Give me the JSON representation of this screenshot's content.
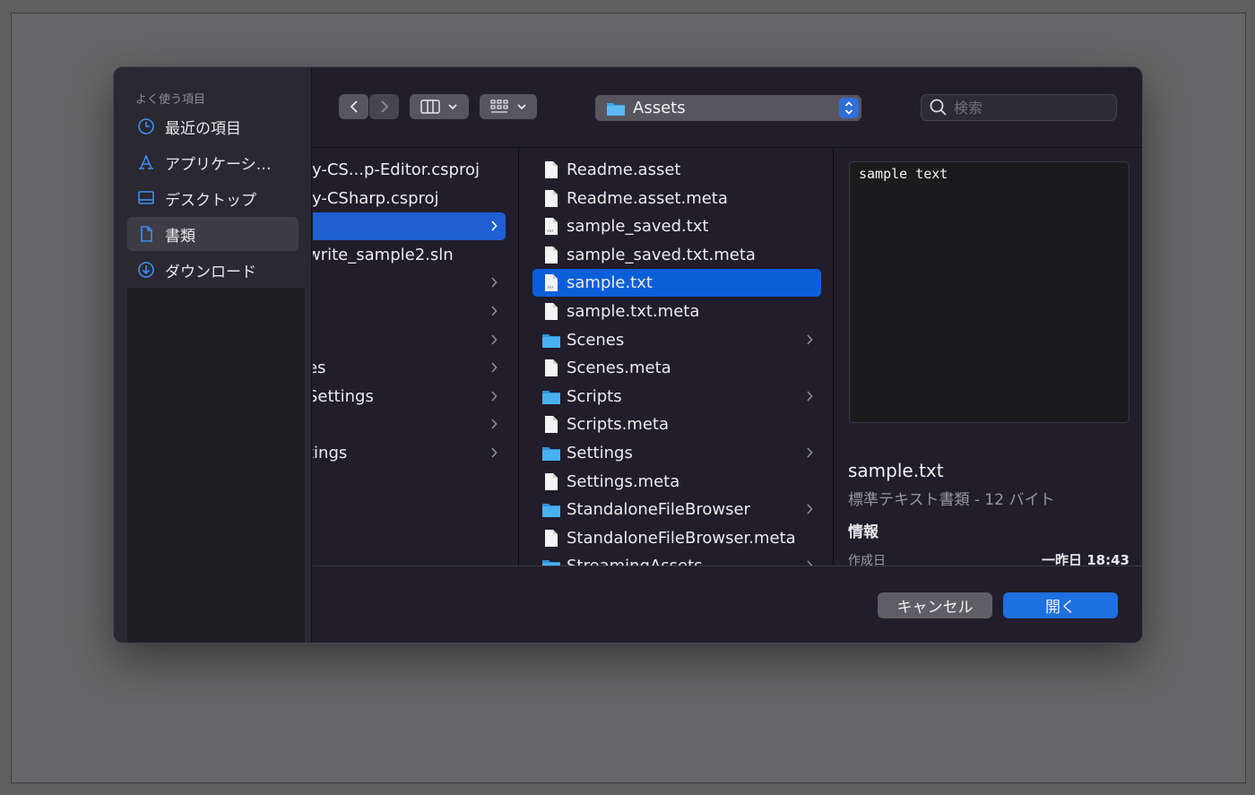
{
  "sidebar": {
    "heading": "よく使う項目",
    "items": [
      {
        "label": "最近の項目",
        "icon": "clock-icon"
      },
      {
        "label": "アプリケーシ…",
        "icon": "applications-icon"
      },
      {
        "label": "デスクトップ",
        "icon": "desktop-icon"
      },
      {
        "label": "書類",
        "icon": "document-icon"
      },
      {
        "label": "ダウンロード",
        "icon": "download-icon"
      }
    ],
    "selected_index": 3
  },
  "toolbar": {
    "path_label": "Assets",
    "search_placeholder": "検索"
  },
  "column1": {
    "rows": [
      {
        "label": "ly-CS...p-Editor.csproj",
        "chevron": false
      },
      {
        "label": "ly-CSharp.csproj",
        "chevron": false
      },
      {
        "label": "",
        "chevron": true,
        "selected": true
      },
      {
        "label": "write_sample2.sln",
        "chevron": false
      },
      {
        "label": "",
        "chevron": true
      },
      {
        "label": "",
        "chevron": true
      },
      {
        "label": "",
        "chevron": true
      },
      {
        "label": "es",
        "chevron": true
      },
      {
        "label": "Settings",
        "chevron": true
      },
      {
        "label": "",
        "chevron": true
      },
      {
        "label": "tings",
        "chevron": true
      }
    ]
  },
  "column2": {
    "rows": [
      {
        "label": "Readme.asset",
        "kind": "file",
        "chevron": false
      },
      {
        "label": "Readme.asset.meta",
        "kind": "file",
        "chevron": false
      },
      {
        "label": "sample_saved.txt",
        "kind": "txt",
        "chevron": false
      },
      {
        "label": "sample_saved.txt.meta",
        "kind": "file",
        "chevron": false
      },
      {
        "label": "sample.txt",
        "kind": "txt",
        "chevron": false,
        "selected": true
      },
      {
        "label": "sample.txt.meta",
        "kind": "file",
        "chevron": false
      },
      {
        "label": "Scenes",
        "kind": "folder",
        "chevron": true
      },
      {
        "label": "Scenes.meta",
        "kind": "file",
        "chevron": false
      },
      {
        "label": "Scripts",
        "kind": "folder",
        "chevron": true
      },
      {
        "label": "Scripts.meta",
        "kind": "file",
        "chevron": false
      },
      {
        "label": "Settings",
        "kind": "folder",
        "chevron": true
      },
      {
        "label": "Settings.meta",
        "kind": "file",
        "chevron": false
      },
      {
        "label": "StandaloneFileBrowser",
        "kind": "folder",
        "chevron": true
      },
      {
        "label": "StandaloneFileBrowser.meta",
        "kind": "file",
        "chevron": false
      },
      {
        "label": "StreamingAssets",
        "kind": "folder",
        "chevron": true
      }
    ]
  },
  "preview": {
    "content": "sample text",
    "filename": "sample.txt",
    "kind": "標準テキスト書類 - 12 バイト",
    "info_heading": "情報",
    "created_label": "作成日",
    "created_value": "一昨日 18:43"
  },
  "buttons": {
    "cancel": "キャンセル",
    "open": "開く"
  },
  "colors": {
    "accent": "#0a5fd9",
    "folder": "#3aa6ee"
  }
}
